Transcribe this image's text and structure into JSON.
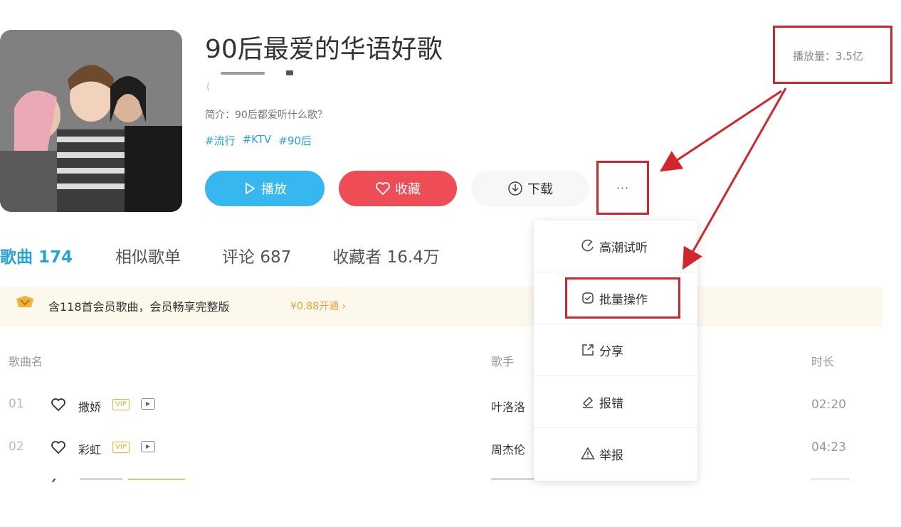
{
  "playlist": {
    "title": "90后最爱的华语好歌",
    "intro": "简介：90后都爱听什么歌？",
    "tags": [
      "#流行",
      "#KTV",
      "#90后"
    ],
    "play_count": "播放量：3.5亿"
  },
  "actions": {
    "play_label": "播放",
    "fav_label": "收藏",
    "download_label": "下载",
    "more_label": "···"
  },
  "tabs": [
    {
      "label": "歌曲 174"
    },
    {
      "label": "相似歌单"
    },
    {
      "label": "评论 687"
    },
    {
      "label": "收藏者 16.4万"
    }
  ],
  "vip_banner": {
    "text": "含118首会员歌曲，会员畅享完整版",
    "link": "¥0.88开通 ›"
  },
  "table": {
    "headers": {
      "name": "歌曲名",
      "singer": "歌手",
      "duration": "时长"
    },
    "rows": [
      {
        "index": "01",
        "name": "撒娇",
        "vip": "VIP",
        "singer": "叶洛洛",
        "duration": "02:20"
      },
      {
        "index": "02",
        "name": "彩虹",
        "vip": "VIP",
        "singer": "周杰伦",
        "duration": "04:23"
      }
    ]
  },
  "menu": {
    "items": [
      {
        "label": "高潮试听",
        "icon": "climax-icon"
      },
      {
        "label": "批量操作",
        "icon": "batch-icon"
      },
      {
        "label": "分享",
        "icon": "share-icon"
      },
      {
        "label": "报错",
        "icon": "report-error-icon"
      },
      {
        "label": "举报",
        "icon": "warning-icon"
      }
    ]
  },
  "colors": {
    "accent": "#28a3d8",
    "play": "#36b7f0",
    "favorite": "#ef4d56",
    "highlight": "#d2262f",
    "vip": "#e9a43b"
  }
}
